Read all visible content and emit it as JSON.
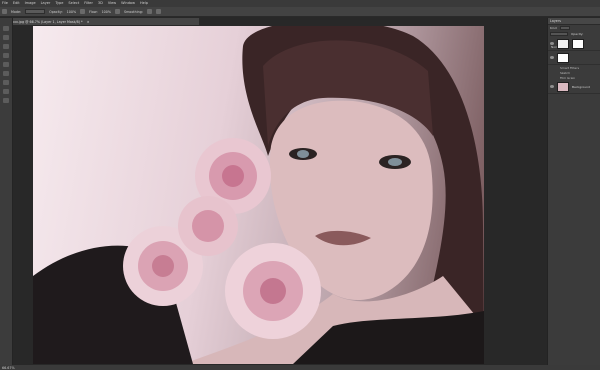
{
  "menu": [
    "File",
    "Edit",
    "Image",
    "Layer",
    "Type",
    "Select",
    "Filter",
    "3D",
    "View",
    "Window",
    "Help"
  ],
  "options": {
    "mode_label": "Mode:",
    "mode_value": "Normal",
    "opacity_label": "Opacity:",
    "opacity_value": "100%",
    "flow_label": "Flow:",
    "flow_value": "100%",
    "smoothing_label": "Smoothing:"
  },
  "document": {
    "tab_title": "IMG_0xxx.jpg @ 66.7% (Layer 1, Layer Mask/8) *",
    "close": "×"
  },
  "status": {
    "zoom": "66.67%"
  },
  "layers_panel": {
    "tab": "Layers",
    "kind_label": "Kind",
    "blend_mode": "Normal",
    "opacity_label": "Opacity:",
    "layers": [
      {
        "name": "Layer 1",
        "thumb_color": "#f2f2f2"
      },
      {
        "name": "Layer 0",
        "thumb_color": "#ffffff"
      },
      {
        "name": "Background",
        "thumb_color": "#d9b9c0"
      }
    ],
    "effects": [
      "Smart Filters",
      "Sketch",
      "Film Grain"
    ]
  }
}
